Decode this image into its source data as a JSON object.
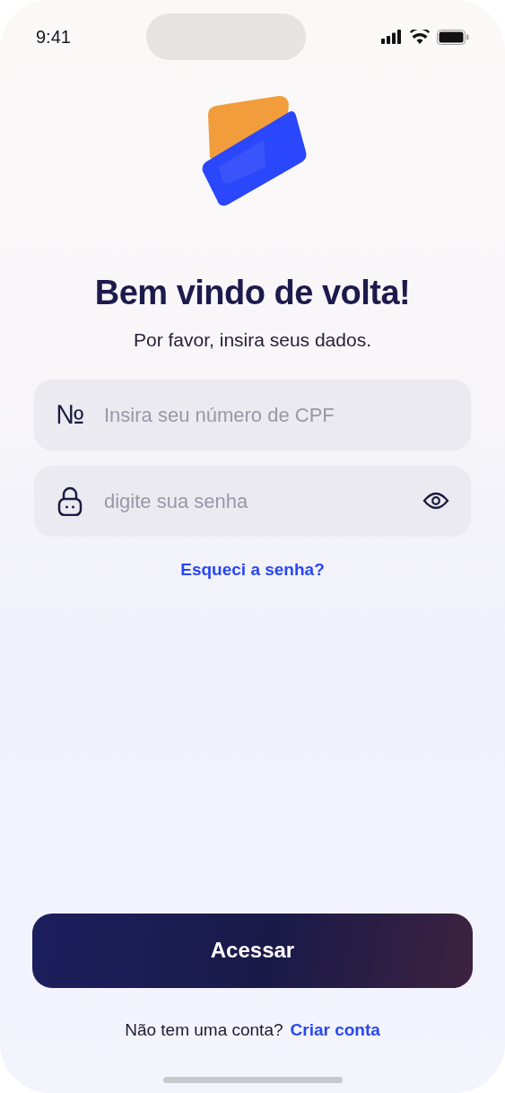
{
  "status_bar": {
    "time": "9:41"
  },
  "header": {
    "title": "Bem vindo de volta!",
    "subtitle": "Por favor, insira seus dados."
  },
  "fields": [
    {
      "kind": "cpf",
      "icon_text": "№",
      "placeholder": "Insira seu número de CPF"
    },
    {
      "kind": "password",
      "placeholder": "digite sua senha"
    }
  ],
  "forgot_link": "Esqueci a senha?",
  "submit_button": "Acessar",
  "signup": {
    "prompt": "Não tem uma conta?",
    "link": "Criar conta"
  }
}
